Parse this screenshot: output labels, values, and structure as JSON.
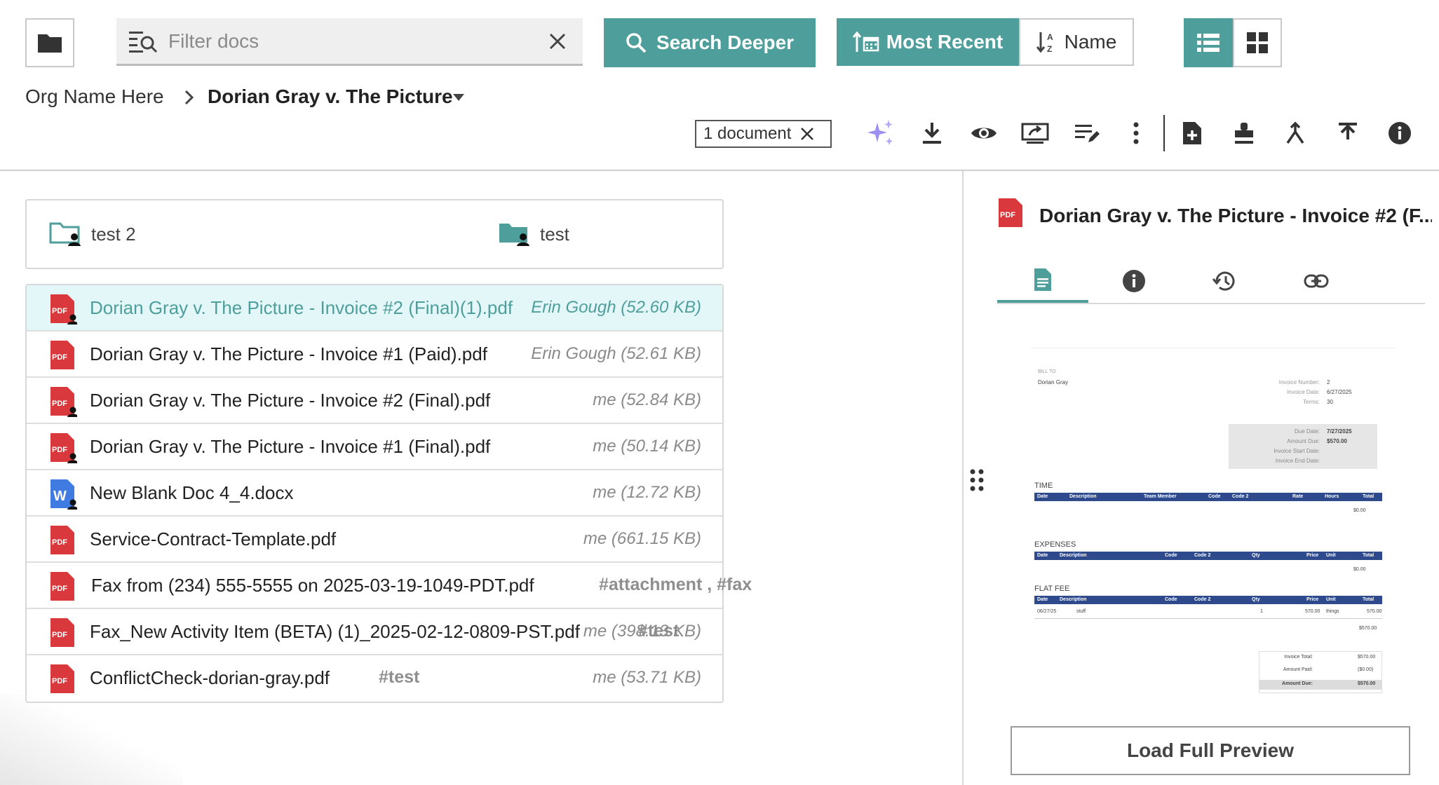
{
  "toolbar": {
    "filter_placeholder": "Filter docs",
    "search_deeper_label": "Search Deeper",
    "sort_recent_label": "Most Recent",
    "sort_name_label": "Name",
    "accent_color": "#4e9f9c"
  },
  "breadcrumb": {
    "org": "Org Name Here",
    "current": "Dorian Gray v. The Picture"
  },
  "selection": {
    "chip_label": "1 document"
  },
  "folders": [
    {
      "label": "test 2",
      "icon": "shared-folder-outline-icon"
    },
    {
      "label": "test",
      "icon": "shared-folder-icon"
    }
  ],
  "files": [
    {
      "name": "Dorian Gray v. The Picture - Invoice #2 (Final)(1).pdf",
      "meta": "Erin Gough (52.60 KB)",
      "tags": "",
      "type": "pdf",
      "shared": true,
      "selected": true
    },
    {
      "name": "Dorian Gray v. The Picture - Invoice #1 (Paid).pdf",
      "meta": "Erin Gough (52.61 KB)",
      "tags": "",
      "type": "pdf",
      "shared": false
    },
    {
      "name": "Dorian Gray v. The Picture - Invoice #2 (Final).pdf",
      "meta": "me (52.84 KB)",
      "tags": "",
      "type": "pdf",
      "shared": true
    },
    {
      "name": "Dorian Gray v. The Picture - Invoice #1 (Final).pdf",
      "meta": "me (50.14 KB)",
      "tags": "",
      "type": "pdf",
      "shared": true
    },
    {
      "name": "New Blank Doc 4_4.docx",
      "meta": "me (12.72 KB)",
      "tags": "",
      "type": "word",
      "shared": true
    },
    {
      "name": "Service-Contract-Template.pdf",
      "meta": "me (661.15 KB)",
      "tags": "",
      "type": "pdf",
      "shared": false
    },
    {
      "name": "Fax from (234) 555-5555 on 2025-03-19-1049-PDT.pdf",
      "meta": "",
      "tags": "#attachment , #fax",
      "type": "pdf",
      "shared": false
    },
    {
      "name": "Fax_New Activity Item (BETA) (1)_2025-02-12-0809-PST.pdf",
      "meta": "me (398.13 KB)",
      "tags": "#test",
      "type": "pdf",
      "shared": false
    },
    {
      "name": "ConflictCheck-dorian-gray.pdf",
      "meta": "me (53.71 KB)",
      "tags": "#test",
      "type": "pdf",
      "shared": false
    }
  ],
  "preview": {
    "title": "Dorian Gray v. The Picture - Invoice #2 (F...",
    "load_button": "Load Full Preview",
    "invoice": {
      "bill_to_label": "BILL TO",
      "bill_to": "Dorian Gray",
      "invoice_number_label": "Invoice Number:",
      "invoice_number": "2",
      "invoice_date_label": "Invoice Date:",
      "invoice_date": "6/27/2025",
      "terms_label": "Terms:",
      "terms": "30",
      "due_date_label": "Due Date:",
      "due_date": "7/27/2025",
      "amount_due_label": "Amount Due:",
      "amount_due": "$570.00",
      "start_date_label": "Invoice Start Date:",
      "end_date_label": "Invoice End Date:",
      "time_heading": "TIME",
      "time_cols": [
        "Date",
        "Description",
        "Team Member",
        "Code",
        "Code 2",
        "Rate",
        "Hours",
        "Total"
      ],
      "time_total": "$0.00",
      "expenses_heading": "EXPENSES",
      "expense_cols": [
        "Date",
        "Description",
        "Code",
        "Code 2",
        "Qty",
        "Price",
        "Unit",
        "Total"
      ],
      "expenses_total": "$0.00",
      "flat_heading": "FLAT FEE",
      "flat_cols": [
        "Date",
        "Description",
        "Code",
        "Code 2",
        "Qty",
        "Price",
        "Unit",
        "Total"
      ],
      "flat_row": [
        "06/27/25",
        "stuff",
        "1",
        "570.00",
        "things",
        "570.00"
      ],
      "flat_total": "$570.00",
      "summary_total_label": "Invoice Total:",
      "summary_total": "$570.00",
      "summary_paid_label": "Amount Paid:",
      "summary_paid": "($0.00)",
      "summary_due_label": "Amount Due:",
      "summary_due": "$570.00"
    }
  }
}
